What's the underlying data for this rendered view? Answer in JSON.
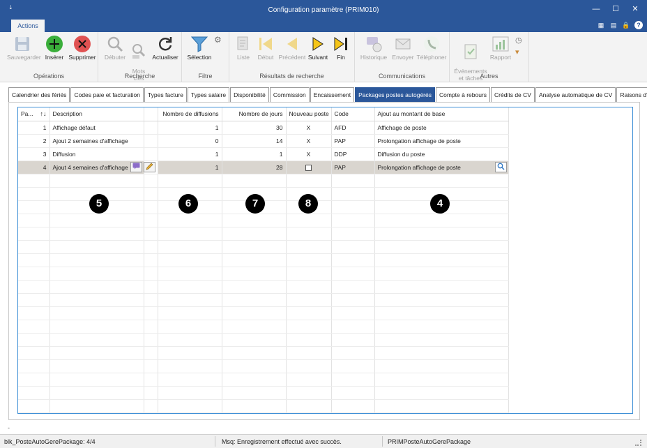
{
  "window": {
    "title": "Configuration paramètre (PRIM010)",
    "quick_access": "⇣",
    "minimize": "—",
    "maximize": "☐",
    "close": "✕"
  },
  "ribbon_tab": "Actions",
  "ribbon": {
    "operations": {
      "label": "Opérations",
      "save": "Sauvegarder",
      "insert": "Insérer",
      "delete": "Supprimer"
    },
    "search": {
      "label": "Recherche",
      "start": "Débuter",
      "keywords": "Mots\nclés",
      "refresh": "Actualiser"
    },
    "filter": {
      "label": "Filtre",
      "selection": "Sélection"
    },
    "results": {
      "label": "Résultats de recherche",
      "list": "Liste",
      "first": "Début",
      "previous": "Précédent",
      "next": "Suivant",
      "last": "Fin"
    },
    "communications": {
      "label": "Communications",
      "history": "Historique",
      "send": "Envoyer",
      "phone": "Téléphoner"
    },
    "others": {
      "label": "Autres",
      "events": "Événements\net tâches",
      "report": "Rapport"
    }
  },
  "tabs": [
    "Calendrier des fériés",
    "Codes paie et facturation",
    "Types facture",
    "Types salaire",
    "Disponibilité",
    "Commission",
    "Encaissement",
    "Packages postes autogérés",
    "Compte à rebours",
    "Crédits de CV",
    "Analyse automatique de CV",
    "Raisons d'absence"
  ],
  "active_tab": "Packages postes autogérés",
  "grid": {
    "columns": [
      "Pa...",
      "Description",
      "",
      "Nombre de diffusions",
      "Nombre de jours",
      "Nouveau poste",
      "Code",
      "Ajout au montant de base"
    ],
    "sort_icon": "↑↓",
    "rows": [
      {
        "pa": "1",
        "description": "Affichage défaut",
        "diffusions": "1",
        "jours": "30",
        "nouveau": "X",
        "code": "AFD",
        "ajout": "Affichage de poste"
      },
      {
        "pa": "2",
        "description": "Ajout 2 semaines d'affichage",
        "diffusions": "0",
        "jours": "14",
        "nouveau": "X",
        "code": "PAP",
        "ajout": "Prolongation affichage de poste"
      },
      {
        "pa": "3",
        "description": "Diffusion",
        "diffusions": "1",
        "jours": "1",
        "nouveau": "X",
        "code": "DDP",
        "ajout": "Diffusion du poste"
      },
      {
        "pa": "4",
        "description": "Ajout 4 semaines d'affichage",
        "diffusions": "1",
        "jours": "28",
        "nouveau": "",
        "code": "PAP",
        "ajout": "Prolongation affichage de poste"
      }
    ]
  },
  "callouts": [
    "5",
    "6",
    "7",
    "8",
    "4"
  ],
  "status": {
    "record": "blk_PosteAutoGerePackage: 4/4",
    "message": "Msq: Enregistrement effectué avec succès.",
    "form": "PRIMPosteAutoGerePackage",
    "left_mark": "-"
  },
  "colors": {
    "accent": "#2b579a",
    "grid_border": "#3d8fd6",
    "selected_row": "#d9d5cf"
  }
}
